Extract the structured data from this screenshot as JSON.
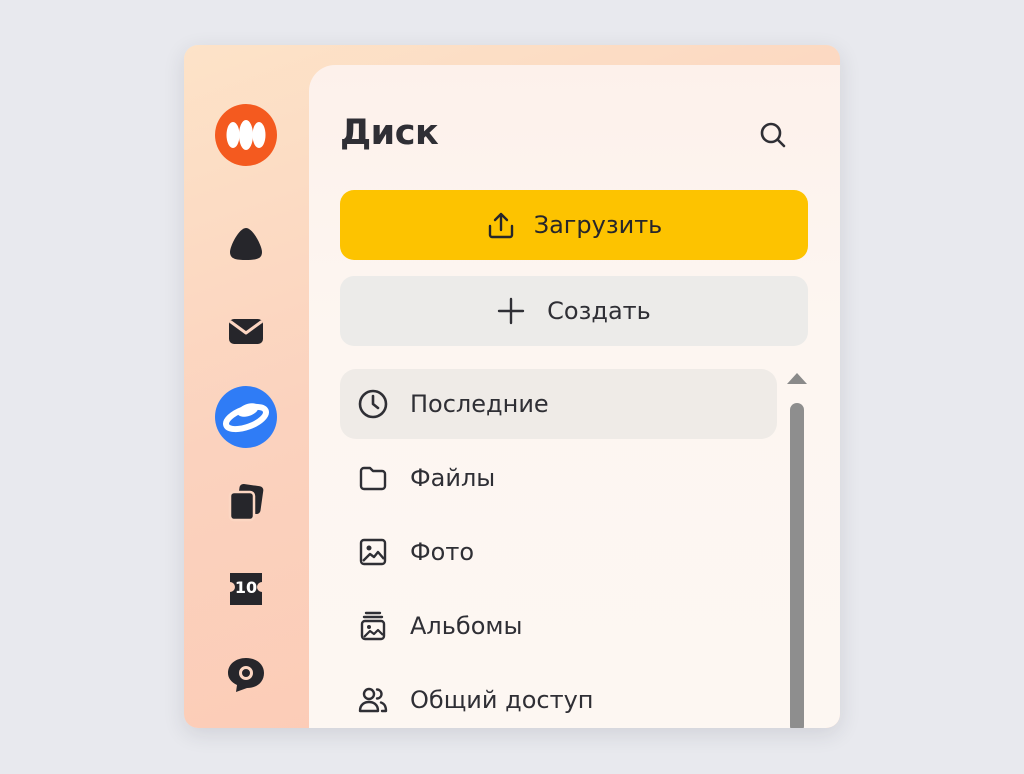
{
  "panel": {
    "title": "Диск",
    "upload_label": "Загрузить",
    "create_label": "Создать"
  },
  "nav": {
    "items": [
      {
        "label": "Последние",
        "icon": "clock-icon",
        "active": true
      },
      {
        "label": "Файлы",
        "icon": "folder-icon",
        "active": false
      },
      {
        "label": "Фото",
        "icon": "photo-icon",
        "active": false
      },
      {
        "label": "Альбомы",
        "icon": "album-icon",
        "active": false
      },
      {
        "label": "Общий доступ",
        "icon": "shared-users-icon",
        "active": false
      }
    ]
  },
  "rail": {
    "badge_number": "10",
    "items": [
      "yandex-360-icon",
      "cloud-icon",
      "mail-icon",
      "disk-icon",
      "documents-icon",
      "calendar-icon",
      "messenger-icon"
    ]
  },
  "colors": {
    "accent": "#fdc300",
    "disk_blue": "#2f7cf6",
    "logo_orange": "#f45a1f"
  }
}
